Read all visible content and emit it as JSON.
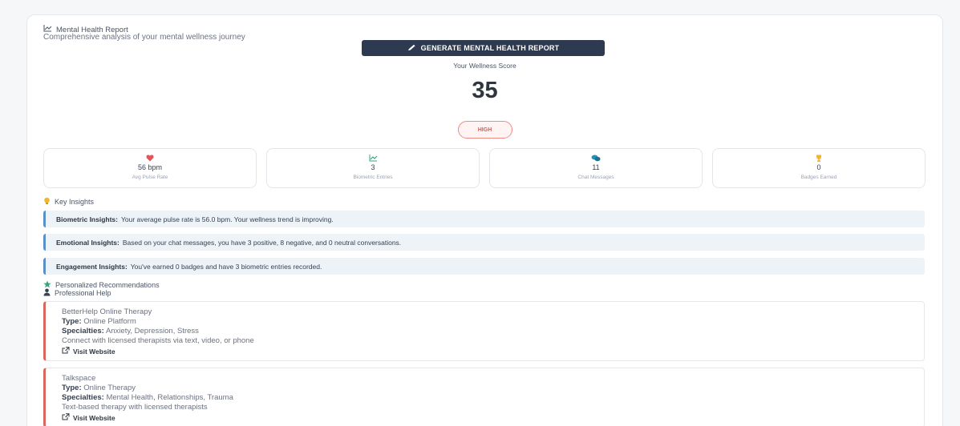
{
  "report": {
    "title": "Mental Health Report",
    "subtitle": "Comprehensive analysis of your mental wellness journey",
    "generate_button": "GENERATE MENTAL HEALTH REPORT",
    "score_label": "Your Wellness Score",
    "score": "35",
    "risk_level": "HIGH",
    "risk_color": "#e05a4e"
  },
  "stats": [
    {
      "icon": "heart-icon",
      "value": "56 bpm",
      "label": "Avg Pulse Rate"
    },
    {
      "icon": "chart-icon",
      "value": "3",
      "label": "Biometric Entries"
    },
    {
      "icon": "chat-icon",
      "value": "11",
      "label": "Chat Messages"
    },
    {
      "icon": "trophy-icon",
      "value": "0",
      "label": "Badges Earned"
    }
  ],
  "insights": {
    "heading": "Key Insights",
    "items": [
      {
        "title": "Biometric Insights:",
        "text": "Your average pulse rate is 56.0 bpm. Your wellness trend is improving."
      },
      {
        "title": "Emotional Insights:",
        "text": "Based on your chat messages, you have 3 positive, 8 negative, and 0 neutral conversations."
      },
      {
        "title": "Engagement Insights:",
        "text": "You've earned 0 badges and have 3 biometric entries recorded."
      }
    ]
  },
  "recommendations": {
    "heading": "Personalized Recommendations",
    "subheading": "Professional Help",
    "type_label": "Type:",
    "specialties_label": "Specialties:",
    "visit_label": "Visit Website",
    "resources": [
      {
        "name": "BetterHelp Online Therapy",
        "type": "Online Platform",
        "specialties": "Anxiety, Depression, Stress",
        "description": "Connect with licensed therapists via text, video, or phone"
      },
      {
        "name": "Talkspace",
        "type": "Online Therapy",
        "specialties": "Mental Health, Relationships, Trauma",
        "description": "Text-based therapy with licensed therapists"
      }
    ]
  },
  "colors": {
    "primary_button": "#2d3a4f",
    "insight_accent": "#5b8fc7",
    "resource_accent": "#d7685e",
    "heart": "#e0565b",
    "chart": "#3aa57a",
    "chat": "#2a8fb5",
    "trophy": "#f2b431",
    "star": "#3aa57a"
  }
}
